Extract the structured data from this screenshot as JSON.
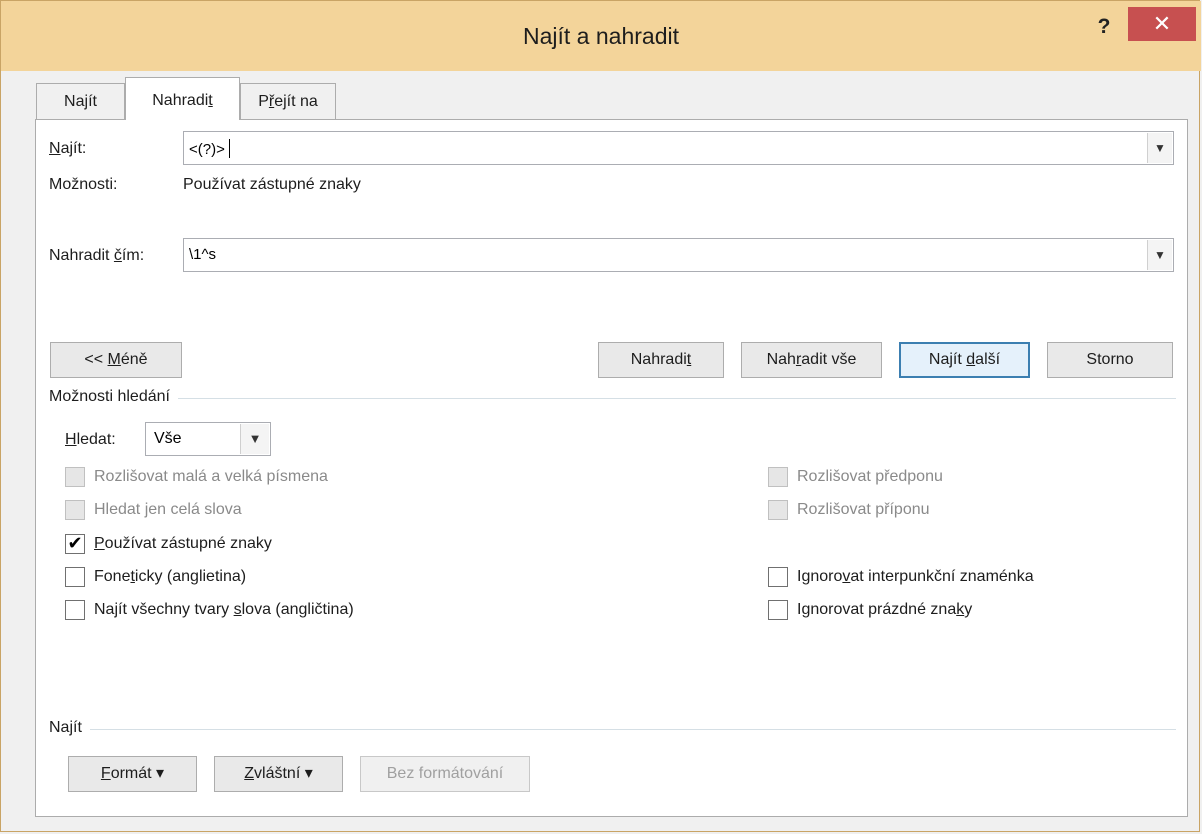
{
  "window": {
    "title": "Najít a nahradit",
    "help_label": "?",
    "close_glyph": "✕",
    "colors": {
      "titlebar": "#f3d49a",
      "close": "#c75050",
      "default_button_border": "#3c7fb1"
    }
  },
  "tabs": [
    {
      "label_pre": "Na",
      "label_u": "j",
      "label_post": "ít",
      "active": false
    },
    {
      "label_pre": "Nahradi",
      "label_u": "t",
      "label_post": "",
      "active": true
    },
    {
      "label_pre": "P",
      "label_u": "ř",
      "label_post": "ejít na",
      "active": false
    }
  ],
  "find": {
    "label_u": "N",
    "label_rest": "ajít:",
    "value": "<(?)>",
    "options_label": "Možnosti:",
    "options_value": "Používat zástupné znaky"
  },
  "replace": {
    "label_pre": "Nahradit ",
    "label_u": "č",
    "label_post": "ím:",
    "value": "\\1^s"
  },
  "buttons": {
    "less_pre": "<< ",
    "less_u": "M",
    "less_post": "éně",
    "replace_pre": "Nahradi",
    "replace_u": "t",
    "replace_post": "",
    "replace_all_pre": "Nah",
    "replace_all_u": "r",
    "replace_all_post": "adit vše",
    "find_next_pre": "Najít ",
    "find_next_u": "d",
    "find_next_post": "alší",
    "cancel": "Storno"
  },
  "search_options": {
    "title": "Možnosti hledání",
    "search_label_u": "H",
    "search_label_rest": "ledat:",
    "search_value": "Vše",
    "checkboxes_left": [
      {
        "pre": "Rozlišovat malá a velká písmena",
        "u": "",
        "post": "",
        "checked": false,
        "disabled": true
      },
      {
        "pre": "Hledat jen celá slova",
        "u": "",
        "post": "",
        "checked": false,
        "disabled": true
      },
      {
        "pre": "",
        "u": "P",
        "post": "oužívat zástupné znaky",
        "checked": true,
        "disabled": false
      },
      {
        "pre": "Fone",
        "u": "t",
        "post": "icky (anglietina)",
        "checked": false,
        "disabled": false
      },
      {
        "pre": "Najít všechny tvary ",
        "u": "s",
        "post": "lova (angličtina)",
        "checked": false,
        "disabled": false
      }
    ],
    "checkboxes_right": [
      {
        "pre": "Rozlišovat předponu",
        "u": "",
        "post": "",
        "checked": false,
        "disabled": true
      },
      {
        "pre": "Rozlišovat příponu",
        "u": "",
        "post": "",
        "checked": false,
        "disabled": true
      },
      {
        "pre": "Ignoro",
        "u": "v",
        "post": "at interpunkční znaménka",
        "checked": false,
        "disabled": false
      },
      {
        "pre": "Ignorovat prázdné zna",
        "u": "k",
        "post": "y",
        "checked": false,
        "disabled": false
      }
    ]
  },
  "find_format": {
    "title": "Najít",
    "format_u": "F",
    "format_rest": "ormát",
    "special_u": "Z",
    "special_rest": "vláštní",
    "dropdown_glyph": "▾",
    "no_format": "Bez formátování"
  }
}
